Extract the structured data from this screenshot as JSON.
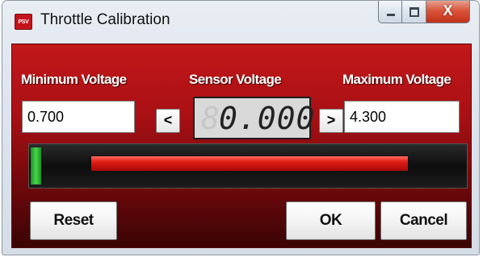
{
  "window": {
    "title": "Throttle Calibration",
    "app_icon_text": "PSV",
    "close_glyph": "X",
    "accent_color": "#c3141c"
  },
  "calibration": {
    "min_label": "Minimum Voltage",
    "min_value": "0.700",
    "sensor_label": "Sensor Voltage",
    "sensor_value": "0.000",
    "sensor_ghost_digit": "8",
    "max_label": "Maximum Voltage",
    "max_value": "4.300",
    "decrease_label": "<",
    "increase_label": ">"
  },
  "gauge": {
    "level_color": "#3fd146",
    "range_color": "#e01a14"
  },
  "buttons": {
    "reset": "Reset",
    "ok": "OK",
    "cancel": "Cancel"
  }
}
